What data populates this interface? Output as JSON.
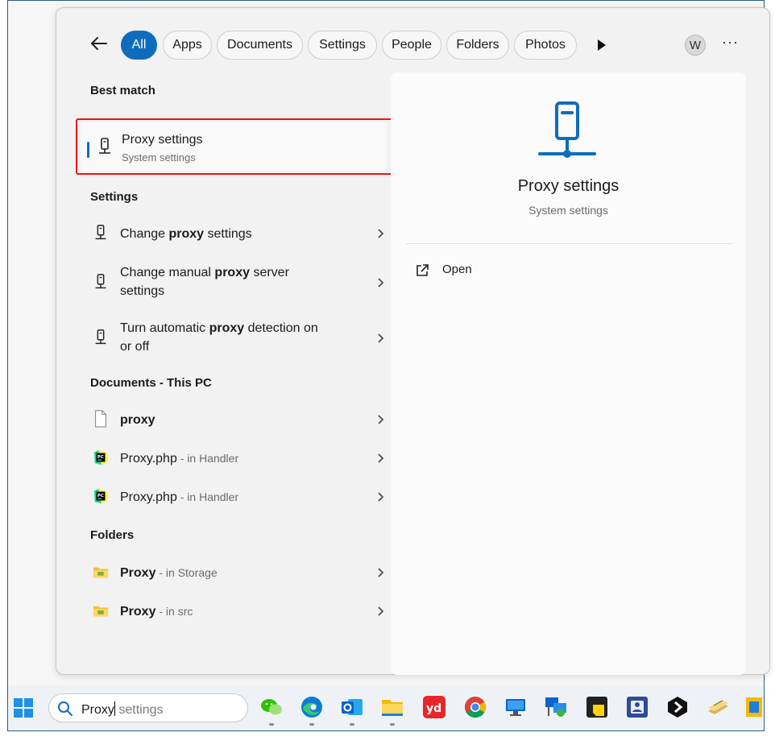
{
  "start_menu": {
    "filters": [
      "All",
      "Apps",
      "Documents",
      "Settings",
      "People",
      "Folders",
      "Photos"
    ],
    "active_filter": "All",
    "user_initial": "W",
    "more_options": "···"
  },
  "best_match": {
    "heading": "Best match",
    "title": "Proxy settings",
    "subtitle": "System settings"
  },
  "settings_section": {
    "heading": "Settings",
    "items": [
      {
        "pre": "Change ",
        "bold": "proxy",
        "post": " settings",
        "line2": ""
      },
      {
        "pre": "Change manual ",
        "bold": "proxy",
        "post": " server",
        "line2": "settings"
      },
      {
        "pre": "Turn automatic ",
        "bold": "proxy",
        "post": " detection on",
        "line2": "or off"
      }
    ]
  },
  "documents_section": {
    "heading": "Documents - This PC",
    "items": [
      {
        "name": "proxy",
        "location": ""
      },
      {
        "name": "Proxy.php",
        "location": " - in Handler"
      },
      {
        "name": "Proxy.php",
        "location": " - in Handler"
      }
    ]
  },
  "folders_section": {
    "heading": "Folders",
    "items": [
      {
        "name": "Proxy",
        "location": " - in Storage"
      },
      {
        "name": "Proxy",
        "location": " - in src"
      }
    ]
  },
  "preview": {
    "title": "Proxy settings",
    "subtitle": "System settings",
    "open_label": "Open"
  },
  "taskbar": {
    "search_typed": "Proxy",
    "search_suggestion": " settings",
    "apps": [
      "wechat-icon",
      "edge-icon",
      "outlook-icon",
      "file-explorer-icon",
      "youdao-icon",
      "chrome-icon",
      "remote-desktop-icon",
      "network-icon",
      "sticky-notes-icon",
      "teams-icon",
      "app-icon",
      "notepad-icon",
      "file-icon"
    ]
  },
  "colors": {
    "accent": "#0f6cbd",
    "highlight_border": "#ee1111"
  }
}
